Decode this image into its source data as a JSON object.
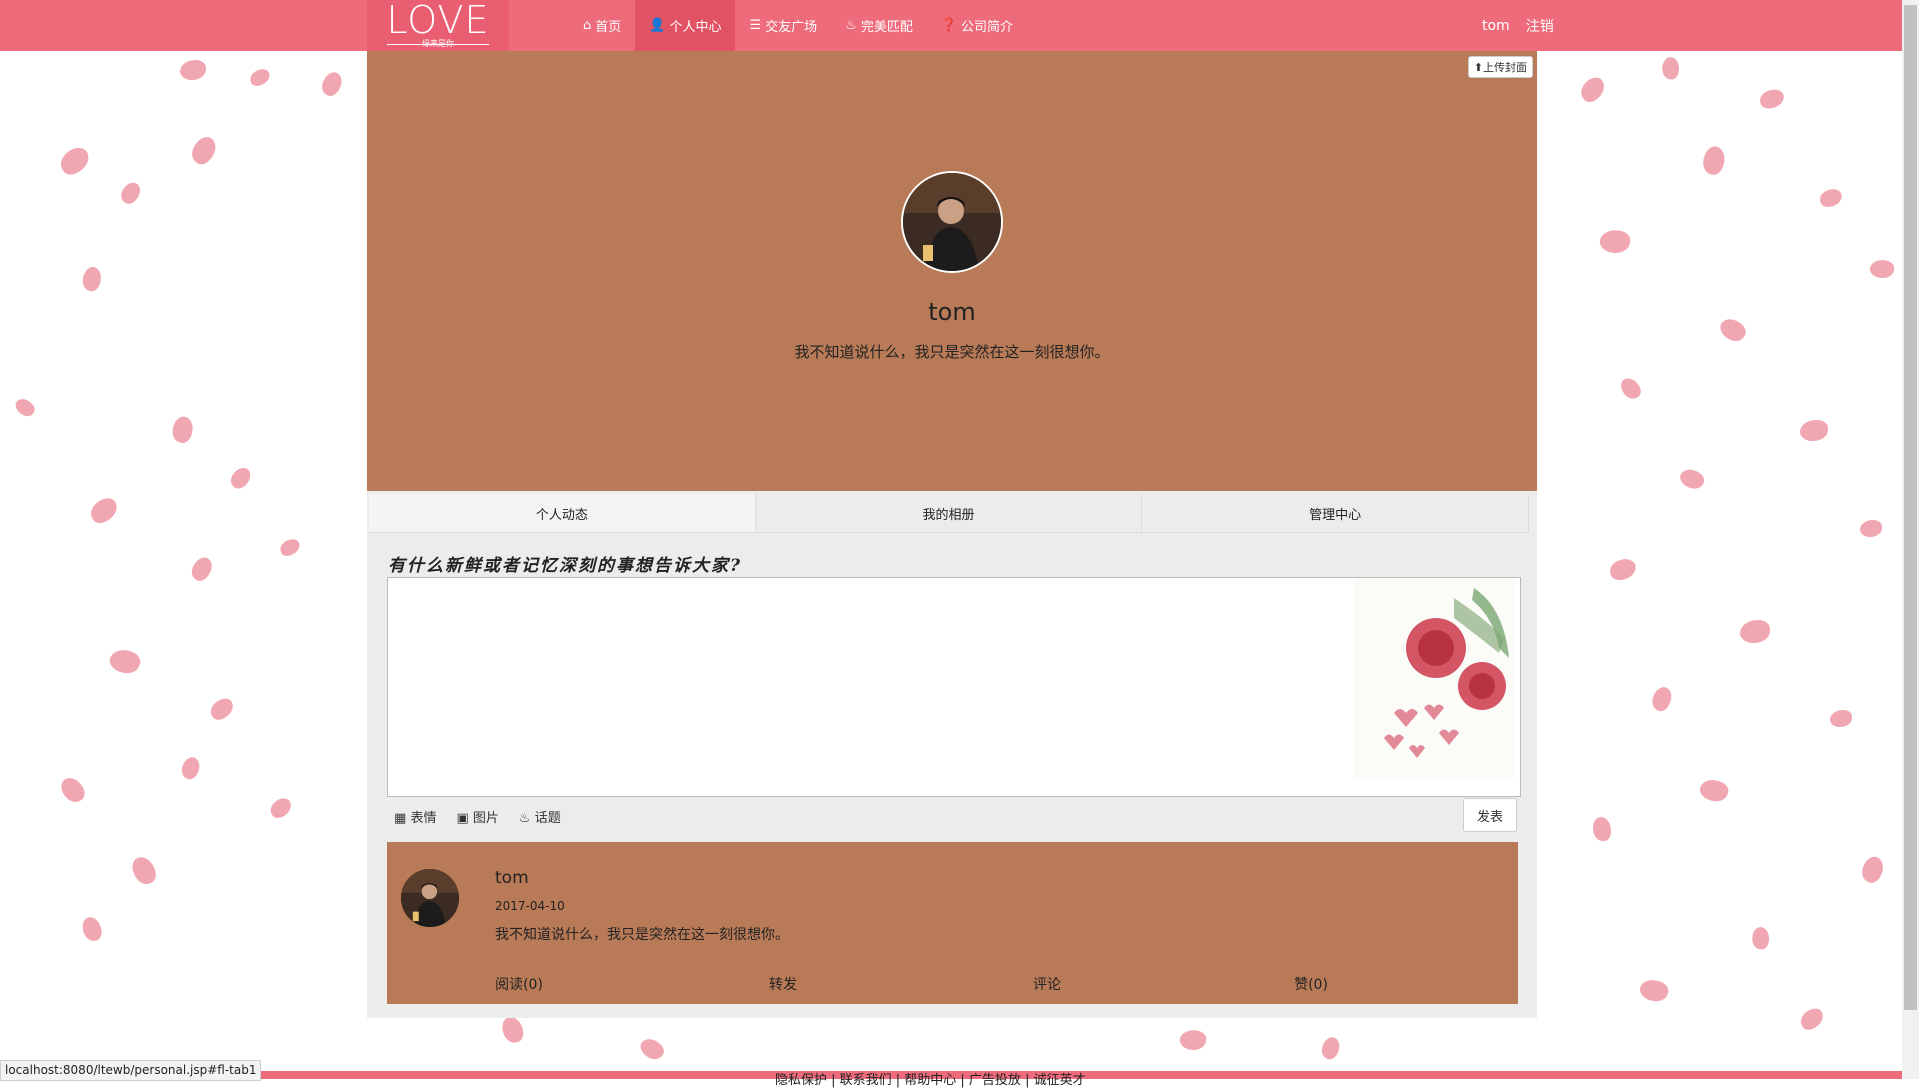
{
  "nav": {
    "logo_text": "LOVE",
    "logo_subtext": "缘来是你",
    "items": [
      {
        "label": "首页",
        "icon": "home-icon",
        "active": false
      },
      {
        "label": "个人中心",
        "icon": "user-icon",
        "active": true
      },
      {
        "label": "交友广场",
        "icon": "list-icon",
        "active": false
      },
      {
        "label": "完美匹配",
        "icon": "fire-icon",
        "active": false
      },
      {
        "label": "公司简介",
        "icon": "question-circle-icon",
        "active": false
      }
    ],
    "username": "tom",
    "logout_label": "注销"
  },
  "profile": {
    "upload_cover_label": "上传封面",
    "name": "tom",
    "bio": "我不知道说什么，我只是突然在这一刻很想你。"
  },
  "tabs": [
    {
      "label": "个人动态"
    },
    {
      "label": "我的相册"
    },
    {
      "label": "管理中心"
    }
  ],
  "composer": {
    "prompt": "有什么新鲜或者记忆深刻的事想告诉大家?",
    "value": "",
    "tools": [
      {
        "label": "表情",
        "icon": "grid-icon"
      },
      {
        "label": "图片",
        "icon": "image-icon"
      },
      {
        "label": "话题",
        "icon": "fire-icon"
      }
    ],
    "publish_label": "发表"
  },
  "feed": [
    {
      "name": "tom",
      "date": "2017-04-10",
      "text": "我不知道说什么，我只是突然在这一刻很想你。",
      "actions": [
        "阅读(0)",
        "转发",
        "评论",
        "赞(0)"
      ]
    }
  ],
  "status_url": "localhost:8080/ltewb/personal.jsp#fl-tab1",
  "footer_text": "隐私保护 | 联系我们 | 帮助中心 | 广告投放 | 诚征英才",
  "colors": {
    "nav": "#ed6b7b",
    "nav_active": "#e15265",
    "cover": "#b97a57",
    "petal": "#ec8a98"
  }
}
